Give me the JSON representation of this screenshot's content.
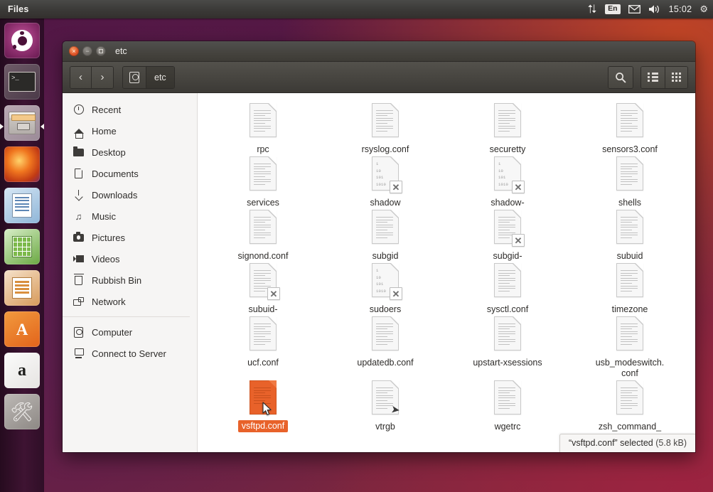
{
  "top_panel": {
    "app_title": "Files",
    "tray": {
      "network_icon": "network-updown-icon",
      "keyboard_layout": "En",
      "mail_icon": "mail-icon",
      "volume_icon": "volume-icon",
      "clock": "15:02",
      "session_icon": "gear-icon"
    }
  },
  "launcher": {
    "items": [
      {
        "name": "ubuntu-dash",
        "label": "Ubuntu Dash"
      },
      {
        "name": "terminal",
        "label": "Terminal"
      },
      {
        "name": "files",
        "label": "Files",
        "running": true
      },
      {
        "name": "firefox",
        "label": "Firefox"
      },
      {
        "name": "libreoffice-writer",
        "label": "LibreOffice Writer"
      },
      {
        "name": "libreoffice-calc",
        "label": "LibreOffice Calc"
      },
      {
        "name": "libreoffice-impress",
        "label": "LibreOffice Impress"
      },
      {
        "name": "ubuntu-software",
        "label": "Ubuntu Software"
      },
      {
        "name": "amazon",
        "label": "Amazon"
      },
      {
        "name": "system-settings",
        "label": "System Settings"
      }
    ]
  },
  "window": {
    "title": "etc",
    "controls": {
      "close": "×",
      "minimize": "−",
      "maximize": "maximize-icon"
    },
    "toolbar": {
      "back": "‹",
      "forward": "›",
      "breadcrumb_computer": "computer-icon",
      "breadcrumb_current": "etc",
      "search": "search-icon",
      "list_view": "list-view-icon",
      "grid_view": "grid-view-icon"
    }
  },
  "sidebar": {
    "items": [
      {
        "label": "Recent",
        "icon": "clock-icon"
      },
      {
        "label": "Home",
        "icon": "home-icon"
      },
      {
        "label": "Desktop",
        "icon": "folder-icon"
      },
      {
        "label": "Documents",
        "icon": "document-icon"
      },
      {
        "label": "Downloads",
        "icon": "download-icon"
      },
      {
        "label": "Music",
        "icon": "music-icon"
      },
      {
        "label": "Pictures",
        "icon": "camera-icon"
      },
      {
        "label": "Videos",
        "icon": "video-icon"
      },
      {
        "label": "Rubbish Bin",
        "icon": "trash-icon"
      },
      {
        "label": "Network",
        "icon": "network-icon"
      }
    ],
    "items_lower": [
      {
        "label": "Computer",
        "icon": "computer-icon"
      },
      {
        "label": "Connect to Server",
        "icon": "server-icon"
      }
    ]
  },
  "files": [
    {
      "name": "rpc",
      "type": "text",
      "badge": "none",
      "selected": false
    },
    {
      "name": "rsyslog.conf",
      "type": "text",
      "badge": "none",
      "selected": false
    },
    {
      "name": "securetty",
      "type": "text",
      "badge": "none",
      "selected": false
    },
    {
      "name": "sensors3.conf",
      "type": "text",
      "badge": "none",
      "selected": false
    },
    {
      "name": "services",
      "type": "text",
      "badge": "none",
      "selected": false
    },
    {
      "name": "shadow",
      "type": "binary",
      "badge": "x",
      "selected": false
    },
    {
      "name": "shadow-",
      "type": "binary",
      "badge": "x",
      "selected": false
    },
    {
      "name": "shells",
      "type": "text",
      "badge": "none",
      "selected": false
    },
    {
      "name": "signond.conf",
      "type": "text",
      "badge": "none",
      "selected": false
    },
    {
      "name": "subgid",
      "type": "text",
      "badge": "none",
      "selected": false
    },
    {
      "name": "subgid-",
      "type": "text",
      "badge": "x",
      "selected": false
    },
    {
      "name": "subuid",
      "type": "text",
      "badge": "none",
      "selected": false
    },
    {
      "name": "subuid-",
      "type": "text",
      "badge": "x",
      "selected": false
    },
    {
      "name": "sudoers",
      "type": "binary",
      "badge": "x",
      "selected": false
    },
    {
      "name": "sysctl.conf",
      "type": "text",
      "badge": "none",
      "selected": false
    },
    {
      "name": "timezone",
      "type": "text",
      "badge": "none",
      "selected": false
    },
    {
      "name": "ucf.conf",
      "type": "text",
      "badge": "none",
      "selected": false
    },
    {
      "name": "updatedb.conf",
      "type": "text",
      "badge": "none",
      "selected": false
    },
    {
      "name": "upstart-xsessions",
      "type": "text",
      "badge": "none",
      "selected": false
    },
    {
      "name": "usb_modeswitch.\nconf",
      "type": "text",
      "badge": "none",
      "selected": false
    },
    {
      "name": "vsftpd.conf",
      "type": "text",
      "badge": "none",
      "selected": true
    },
    {
      "name": "vtrgb",
      "type": "text",
      "badge": "link",
      "selected": false
    },
    {
      "name": "wgetrc",
      "type": "text",
      "badge": "none",
      "selected": false
    },
    {
      "name": "zsh_command_",
      "type": "text",
      "badge": "none",
      "selected": false
    }
  ],
  "binary_icon_text": "1\n10\n101\n1010",
  "statusbar": {
    "text": "“vsftpd.conf” selected",
    "size": "(5.8 kB)"
  },
  "colors": {
    "selection": "#e8622a",
    "panel": "#3c3b39",
    "sidebar_bg": "#f6f5f4",
    "desktop": "#5b1b46"
  }
}
